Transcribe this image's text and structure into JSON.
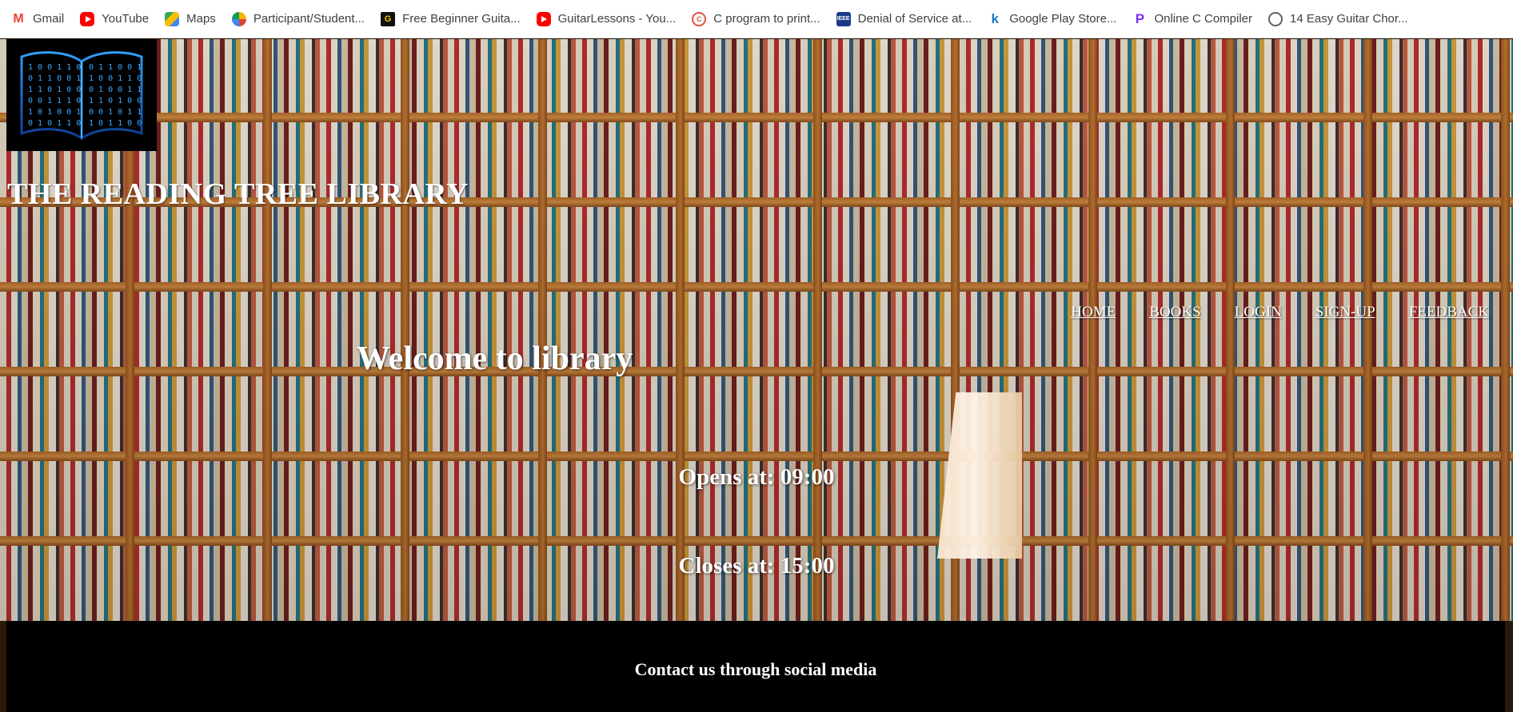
{
  "bookmarks": [
    {
      "label": "Gmail",
      "icon": "gmail-icon"
    },
    {
      "label": "YouTube",
      "icon": "youtube-icon"
    },
    {
      "label": "Maps",
      "icon": "maps-icon"
    },
    {
      "label": "Participant/Student...",
      "icon": "participant-icon"
    },
    {
      "label": "Free Beginner Guita...",
      "icon": "guitar-icon"
    },
    {
      "label": "GuitarLessons - You...",
      "icon": "youtube-icon"
    },
    {
      "label": "C program to print...",
      "icon": "c-program-icon"
    },
    {
      "label": "Denial of Service at...",
      "icon": "ieee-icon"
    },
    {
      "label": "Google Play Store...",
      "icon": "k-icon"
    },
    {
      "label": "Online C Compiler",
      "icon": "online-compiler-icon"
    },
    {
      "label": "14 Easy Guitar Chor...",
      "icon": "globe-icon"
    }
  ],
  "site": {
    "title": "THE READING TREE LIBRARY",
    "welcome": "Welcome to library",
    "opens": "Opens at: 09:00",
    "closes": "Closes at: 15:00"
  },
  "nav": {
    "home": "HOME",
    "books": "BOOKS",
    "login": "LOGIN",
    "signup": "SIGN-UP",
    "feedback": "FEEDBACK"
  },
  "footer": {
    "heading": "Contact us through social media"
  }
}
